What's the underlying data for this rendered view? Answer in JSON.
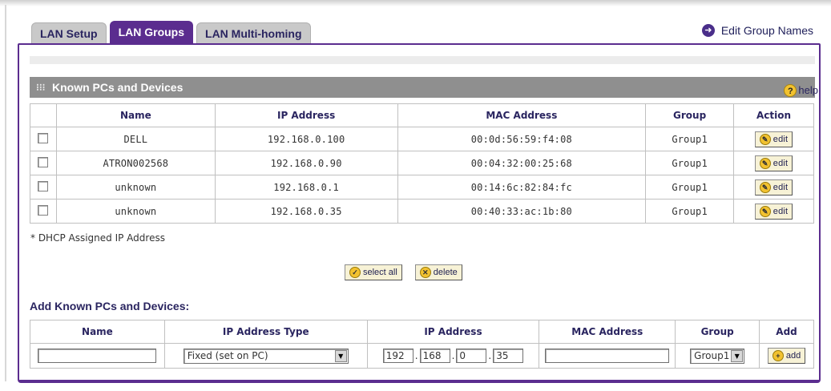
{
  "tabs": [
    {
      "label": "LAN Setup",
      "active": false
    },
    {
      "label": "LAN Groups",
      "active": true
    },
    {
      "label": "LAN Multi-homing",
      "active": false
    }
  ],
  "edit_group_names": "Edit Group Names",
  "known": {
    "title": "Known PCs and Devices",
    "help_label": "help",
    "columns": [
      "Name",
      "IP Address",
      "MAC Address",
      "Group",
      "Action"
    ],
    "rows": [
      {
        "name": "DELL",
        "ip": "192.168.0.100",
        "mac": "00:0d:56:59:f4:08",
        "group": "Group1",
        "action": "edit"
      },
      {
        "name": "ATRON002568",
        "ip": "192.168.0.90",
        "mac": "00:04:32:00:25:68",
        "group": "Group1",
        "action": "edit"
      },
      {
        "name": "unknown",
        "ip": "192.168.0.1",
        "mac": "00:14:6c:82:84:fc",
        "group": "Group1",
        "action": "edit"
      },
      {
        "name": "unknown",
        "ip": "192.168.0.35",
        "mac": "00:40:33:ac:1b:80",
        "group": "Group1",
        "action": "edit"
      }
    ],
    "note": "* DHCP Assigned IP Address",
    "select_all_label": "select all",
    "delete_label": "delete"
  },
  "add": {
    "title": "Add Known PCs and Devices:",
    "columns": [
      "Name",
      "IP Address Type",
      "IP Address",
      "MAC Address",
      "Group",
      "Add"
    ],
    "name_value": "",
    "ip_type": "Fixed (set on PC)",
    "ip_octets": [
      "192",
      "168",
      "0",
      "35"
    ],
    "mac_value": "",
    "group": "Group1",
    "add_label": "add"
  },
  "colors": {
    "accent": "#5b2d8f",
    "section_bar": "#8f8f8f",
    "button_bg": "#f7f2d6",
    "icon_yellow": "#f2c230"
  }
}
